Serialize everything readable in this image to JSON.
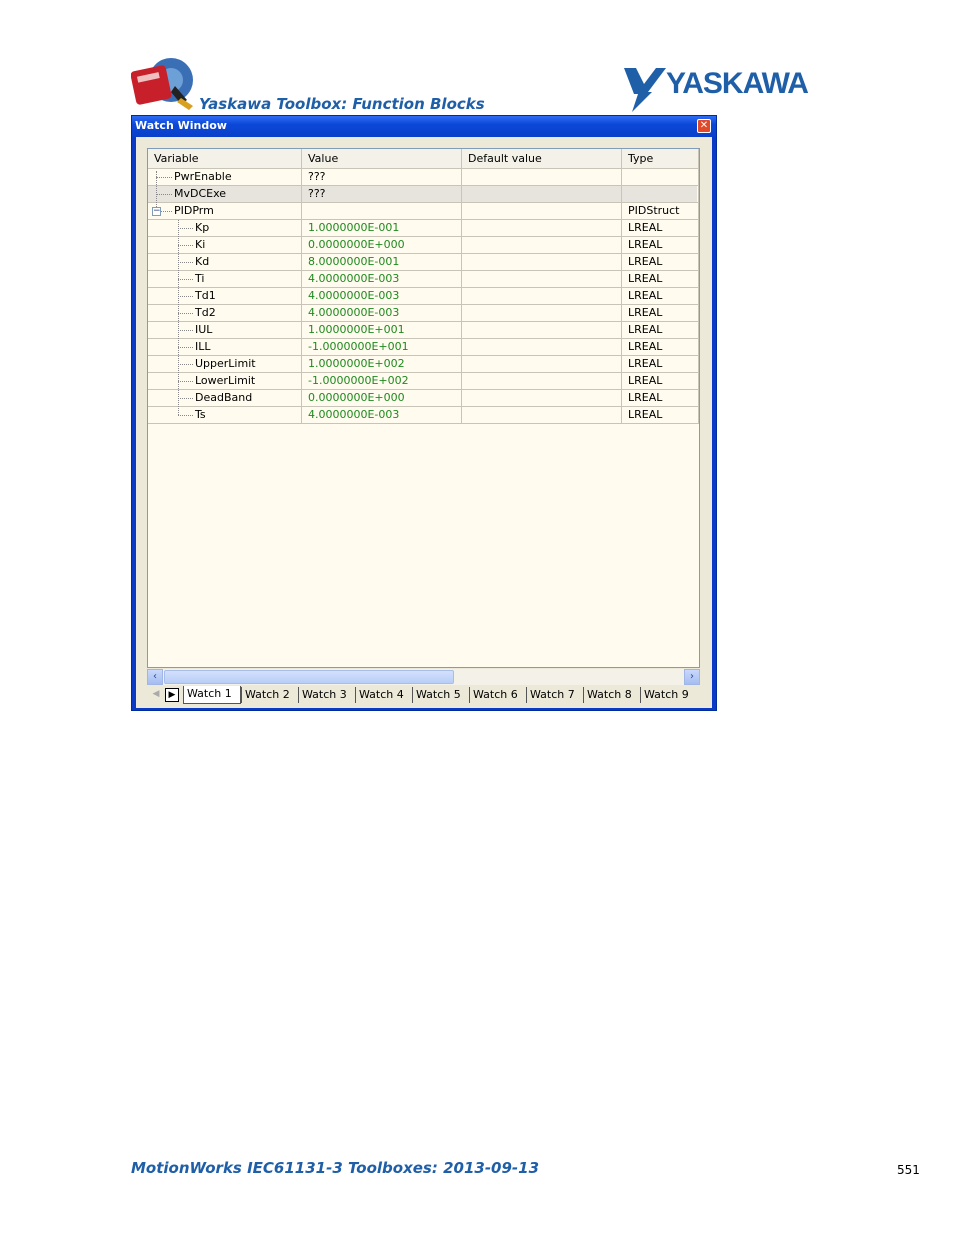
{
  "header": {
    "title": "Yaskawa Toolbox: Function Blocks",
    "brand": "YASKAWA",
    "brand_color": "#1f5fa8"
  },
  "window": {
    "title": "Watch Window",
    "close_icon": "close-icon"
  },
  "grid": {
    "columns": [
      "Variable",
      "Value",
      "Default value",
      "Type"
    ],
    "rows": [
      {
        "name": "PwrEnable",
        "value": "???",
        "default": "",
        "type": "",
        "level": 0
      },
      {
        "name": "MvDCExe",
        "value": "???",
        "default": "",
        "type": "",
        "level": 0
      },
      {
        "name": "PIDPrm",
        "value": "",
        "default": "",
        "type": "PIDStruct",
        "level": 0,
        "expanded": true
      },
      {
        "name": "Kp",
        "value": "1.0000000E-001",
        "default": "",
        "type": "LREAL",
        "level": 1
      },
      {
        "name": "Ki",
        "value": "0.0000000E+000",
        "default": "",
        "type": "LREAL",
        "level": 1
      },
      {
        "name": "Kd",
        "value": "8.0000000E-001",
        "default": "",
        "type": "LREAL",
        "level": 1
      },
      {
        "name": "Ti",
        "value": "4.0000000E-003",
        "default": "",
        "type": "LREAL",
        "level": 1
      },
      {
        "name": "Td1",
        "value": "4.0000000E-003",
        "default": "",
        "type": "LREAL",
        "level": 1
      },
      {
        "name": "Td2",
        "value": "4.0000000E-003",
        "default": "",
        "type": "LREAL",
        "level": 1
      },
      {
        "name": "IUL",
        "value": "1.0000000E+001",
        "default": "",
        "type": "LREAL",
        "level": 1
      },
      {
        "name": "ILL",
        "value": "-1.0000000E+001",
        "default": "",
        "type": "LREAL",
        "level": 1
      },
      {
        "name": "UpperLimit",
        "value": "1.0000000E+002",
        "default": "",
        "type": "LREAL",
        "level": 1
      },
      {
        "name": "LowerLimit",
        "value": "-1.0000000E+002",
        "default": "",
        "type": "LREAL",
        "level": 1
      },
      {
        "name": "DeadBand",
        "value": "0.0000000E+000",
        "default": "",
        "type": "LREAL",
        "level": 1
      },
      {
        "name": "Ts",
        "value": "4.0000000E-003",
        "default": "",
        "type": "LREAL",
        "level": 1
      }
    ],
    "selected_row": 1,
    "value_color": "#1f8a1f"
  },
  "tabs": {
    "items": [
      "Watch 1",
      "Watch 2",
      "Watch 3",
      "Watch 4",
      "Watch 5",
      "Watch 6",
      "Watch 7",
      "Watch 8",
      "Watch 9"
    ],
    "active": 0
  },
  "footer": {
    "text": "MotionWorks IEC61131-3 Toolboxes: 2013-09-13",
    "page": "551"
  }
}
